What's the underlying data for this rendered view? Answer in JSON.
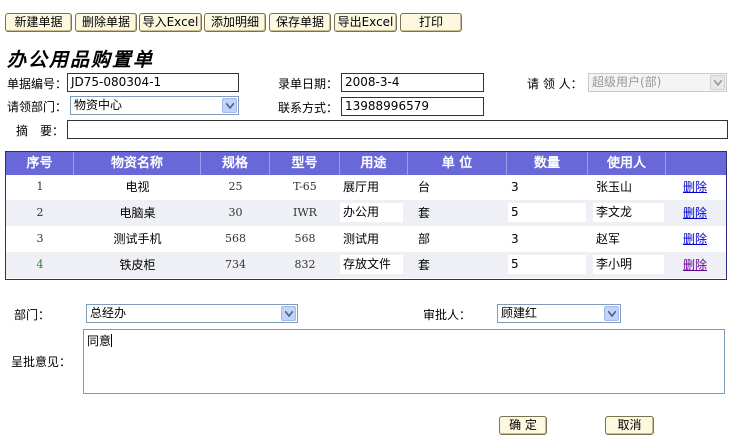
{
  "toolbar": {
    "new_label": "新建单据",
    "delete_label": "删除单据",
    "import_label": "导入Excel",
    "add_detail_label": "添加明细",
    "save_label": "保存单据",
    "export_label": "导出Excel",
    "print_label": "打印"
  },
  "form": {
    "title": "办公用品购置单",
    "doc_no_label": "单据编号：",
    "doc_no_value": "JD75-080304-1",
    "entry_date_label": "录单日期：",
    "entry_date_value": "2008-3-4",
    "claimant_label": "请 领 人：",
    "claimant_value": "超级用户(部)",
    "dept_label": "请领部门：",
    "dept_value": "物资中心",
    "contact_label": "联系方式：",
    "contact_value": "13988996579",
    "summary_label": "摘　要：",
    "summary_value": ""
  },
  "grid": {
    "columns": [
      "序号",
      "物资名称",
      "规格",
      "型号",
      "用途",
      "单 位",
      "数量",
      "使用人"
    ],
    "delete_label": "删除",
    "rows": [
      {
        "no": "1",
        "name": "电视",
        "spec": "25",
        "model": "T-65",
        "usage": "展厅用",
        "unit": "台",
        "qty": "3",
        "user": "张玉山"
      },
      {
        "no": "2",
        "name": "电脑桌",
        "spec": "30",
        "model": "IWR",
        "usage": "办公用",
        "unit": "套",
        "qty": "5",
        "user": "李文龙"
      },
      {
        "no": "3",
        "name": "测试手机",
        "spec": "568",
        "model": "568",
        "usage": "测试用",
        "unit": "部",
        "qty": "3",
        "user": "赵军"
      },
      {
        "no": "4",
        "name": "铁皮柜",
        "spec": "734",
        "model": "832",
        "usage": "存放文件",
        "unit": "套",
        "qty": "5",
        "user": "李小明"
      }
    ]
  },
  "approval": {
    "dept_label": "部门：",
    "dept_value": "总经办",
    "approver_label": "审批人：",
    "approver_value": "顾建红",
    "opinion_label": "呈批意见：",
    "opinion_value": "同意",
    "confirm_label": "确 定",
    "cancel_label": "取消"
  },
  "colors": {
    "grid_header": "#6868d8",
    "link": "#0000cc",
    "button_bg": "#fdf8e0"
  }
}
